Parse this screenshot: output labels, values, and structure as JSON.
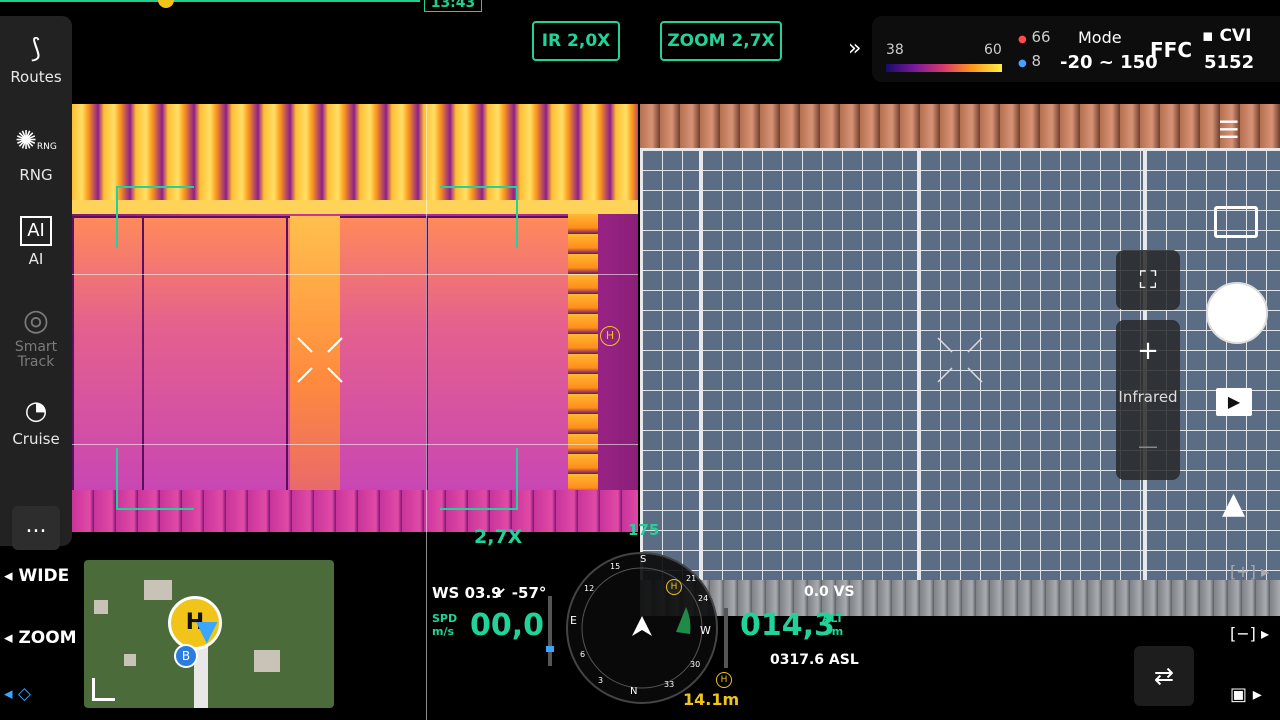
{
  "top": {
    "time": "13:43"
  },
  "left_rail": {
    "routes_label": "Routes",
    "rng_label": "RNG",
    "rng_icon_text": "RNG",
    "ai_label": "AI",
    "smart_track_label": "Smart Track",
    "cruise_label": "Cruise",
    "more_label": "...",
    "wide_label": "WIDE",
    "zoom_label": "ZOOM"
  },
  "header": {
    "ir_zoom": "IR  2,0X",
    "zoom": "ZOOM  2,7X"
  },
  "thermal_panel": {
    "scale_min": "38",
    "scale_max": "60",
    "hot_value": "66",
    "cold_value": "8",
    "mode_label": "Mode",
    "mode_range": "-20 ~ 150",
    "ffc_label": "FFC",
    "storage_label": "CVI",
    "storage_value": "5152"
  },
  "view": {
    "zoom_indicator": "2,7X",
    "heading_mark": "175"
  },
  "right_controls": {
    "infrared_label": "Infrared"
  },
  "telemetry": {
    "wind_speed": "WS 03.9",
    "wind_dir": "-57°",
    "spd_label": "SPD",
    "spd_unit": "m/s",
    "speed": "00,0",
    "vs": "0.0 VS",
    "altitude": "014,3",
    "alt_label": "ALT",
    "alt_unit": "m",
    "asl": "0317.6 ASL",
    "distance": "14.1m"
  },
  "compass": {
    "s": "S",
    "e": "E",
    "w": "W",
    "n": "N",
    "t15": "15",
    "t21": "21",
    "t24": "24",
    "t12": "12",
    "t6": "6",
    "t3": "3",
    "t33": "33",
    "t30": "30"
  },
  "colors": {
    "accent": "#20d39a",
    "warning": "#f0c419"
  }
}
